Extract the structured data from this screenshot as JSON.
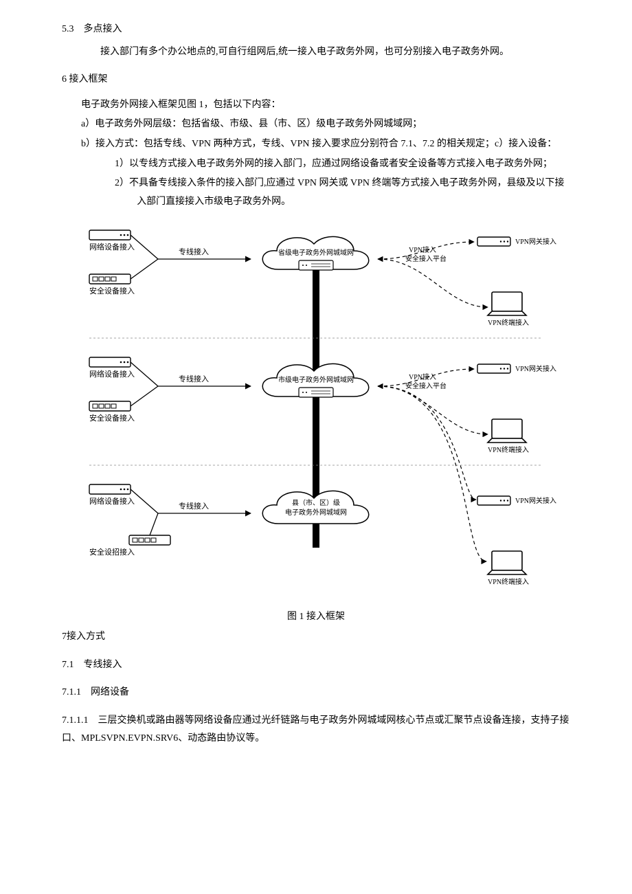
{
  "sec53": {
    "num": "5.3",
    "title": "多点接入",
    "para": "接入部门有多个办公地点的,可自行组网后,统一接入电子政务外网，也可分别接入电子政务外网。"
  },
  "sec6": {
    "title": "6 接入框架",
    "intro": "电子政务外网接入框架见图 1，包括以下内容：",
    "a": "a）电子政务外网层级：包括省级、市级、县（市、区）级电子政务外网城域网；",
    "b": "b）接入方式：包括专线、VPN 两种方式，专线、VPN 接入要求应分别符合 7.1、7.2 的相关规定；c）接入设备：",
    "c1": "1）以专线方式接入电子政务外网的接入部门，应通过网络设备或者安全设备等方式接入电子政务外网；",
    "c2": "2）不具备专线接入条件的接入部门,应通过 VPN 网关或 VPN 终端等方式接入电子政务外网，县级及以下接入部门直接接入市级电子政务外网。"
  },
  "figure": {
    "caption": "图 1 接入框架",
    "leftLabels": {
      "netDevice": "网络设备接入",
      "secDevice": "安全设备接入",
      "secDeviceAlt": "安全设招接入",
      "leased": "专线接入"
    },
    "clouds": {
      "province": "省级电子政务外网城域网",
      "city": "市级电子政务外网城域网",
      "county1": "县（市、区）级",
      "county2": "电子政务外网城域网"
    },
    "rightLabels": {
      "vpnAccess": "VPN接入",
      "platform": "安全接入平台",
      "vpnGateway": "VPN网关接入",
      "vpnTerminal": "VPN终端接入"
    }
  },
  "sec7": {
    "title": "7接入方式",
    "s71": "7.1 专线接入",
    "s711": "7.1.1 网络设备",
    "s7111": "7.1.1.1 三层交换机或路由器等网络设备应通过光纤链路与电子政务外网城域网核心节点或汇聚节点设备连接，支持子接口、MPLSVPN.EVPN.SRV6、动态路由协议等。"
  }
}
